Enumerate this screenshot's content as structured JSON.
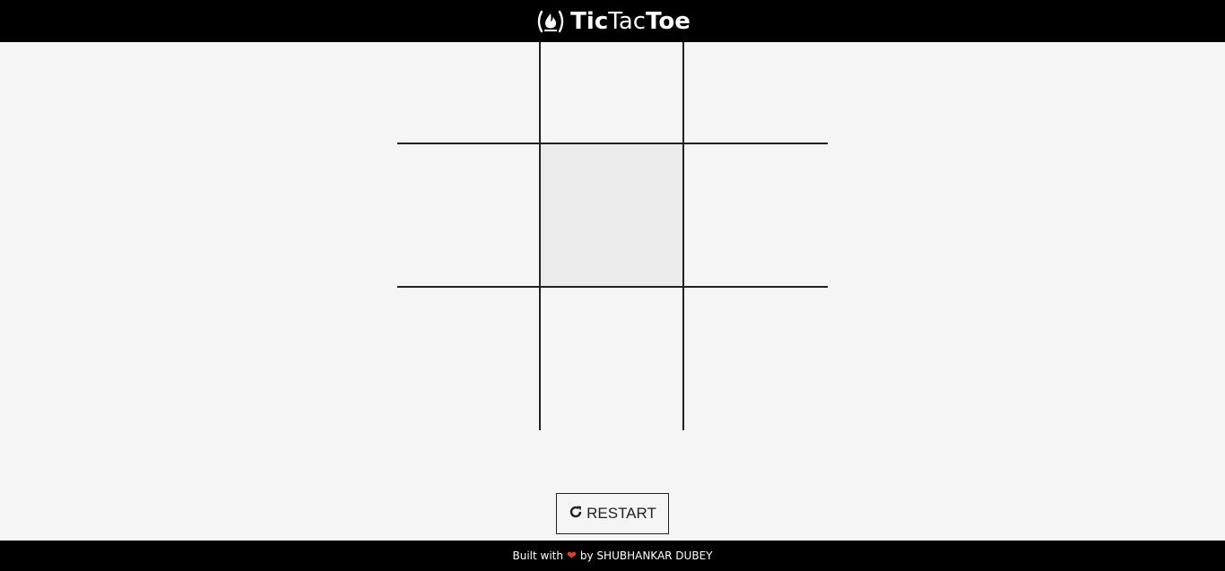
{
  "header": {
    "title_part1": "Tic",
    "title_part2": "Tac",
    "title_part3": "Toe",
    "logo_icon": "flame-logo-icon"
  },
  "board": {
    "cells": [
      "",
      "",
      "",
      "",
      "",
      "",
      "",
      "",
      ""
    ],
    "hovered_cell_index": 4
  },
  "restart": {
    "label": "RESTART",
    "icon": "refresh-icon"
  },
  "footer": {
    "prefix": "Built with",
    "heart_icon": "heart-icon",
    "suffix": "by SHUBHANKAR DUBEY"
  },
  "colors": {
    "header_bg": "#000000",
    "page_bg": "#f5f5f5",
    "hover_cell": "#ebebeb",
    "grid_line": "#222222",
    "heart": "#e53935"
  }
}
